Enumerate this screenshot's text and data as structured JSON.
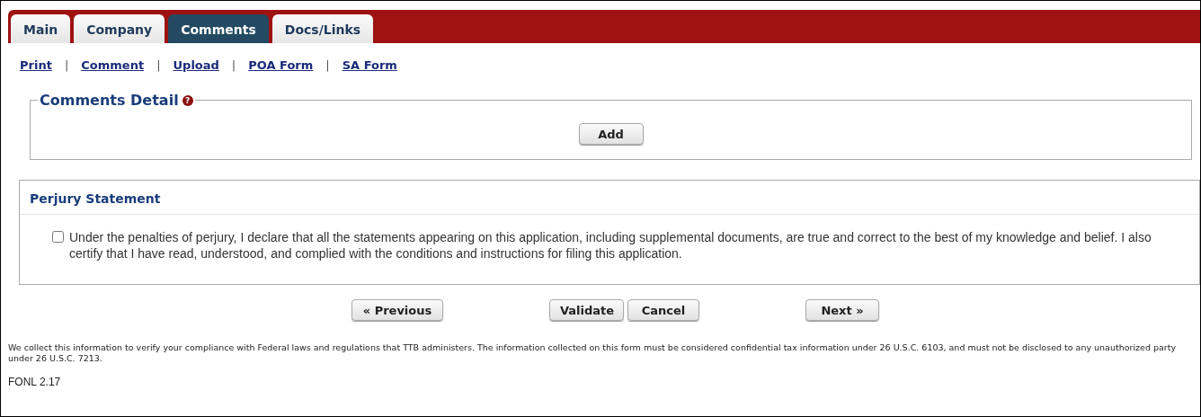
{
  "tabs": [
    {
      "label": "Main",
      "selected": false
    },
    {
      "label": "Company",
      "selected": false
    },
    {
      "label": "Comments",
      "selected": true
    },
    {
      "label": "Docs/Links",
      "selected": false
    }
  ],
  "links": [
    {
      "label": "Print"
    },
    {
      "separator": "|",
      "label": "Comment"
    },
    {
      "separator": "|",
      "label": "Upload"
    },
    {
      "separator": "|",
      "label": "POA Form"
    },
    {
      "separator": "|",
      "label": "SA Form"
    }
  ],
  "comments_detail": {
    "title": "Comments Detail",
    "help_icon": "?",
    "add_button": "Add"
  },
  "perjury": {
    "title": "Perjury Statement",
    "checked": false,
    "statement": "Under the penalties of perjury, I declare that all the statements appearing on this application, including supplemental documents, are true and correct to the best of my knowledge and belief. I also certify that I have read, understood, and complied with the conditions and instructions for filing this application."
  },
  "buttons": {
    "previous": "« Previous",
    "validate": "Validate",
    "cancel": "Cancel",
    "next": "Next »"
  },
  "notice": "We collect this information to verify your compliance with Federal laws and regulations that TTB administers. The information collected on this form must be considered confidential tax information under 26 U.S.C. 6103, and must not be disclosed to any unauthorized party under 26 U.S.C. 7213.",
  "version": "FONL 2.17"
}
